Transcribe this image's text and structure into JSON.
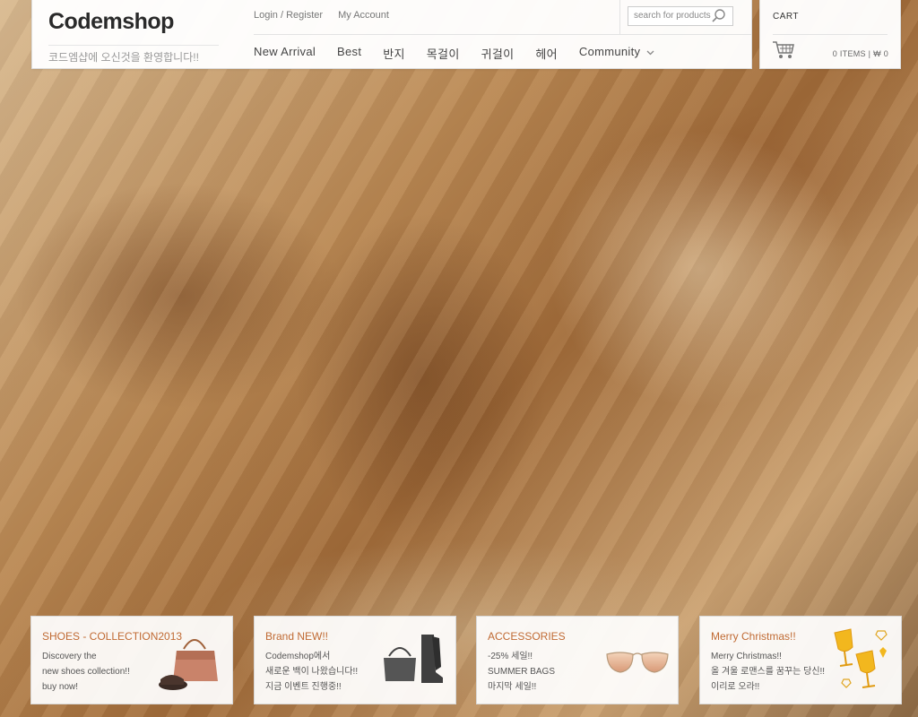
{
  "header": {
    "logo": "Codemshop",
    "tagline": "코드엠샵에 오신것을 환영합니다!!",
    "top_links": [
      "Login / Register",
      "My Account"
    ],
    "search": {
      "placeholder": "search for products",
      "icon": "search-icon"
    },
    "nav": [
      "New Arrival",
      "Best",
      "반지",
      "목걸이",
      "귀걸이",
      "헤어",
      "Community"
    ]
  },
  "cart": {
    "title": "CART",
    "icon": "shopping-cart-icon",
    "summary": "0 ITEMS | ₩ 0"
  },
  "promos": [
    {
      "title": "SHOES - COLLECTION2013",
      "lines": [
        "Discovery the",
        "new shoes collection!!",
        "buy now!"
      ],
      "icon": "handbag-and-shoes-image"
    },
    {
      "title": "Brand NEW!!",
      "lines": [
        "Codemshop에서",
        "새로운 백이 나왔습니다!!",
        "지금 이벤트 진행중!!"
      ],
      "icon": "bag-and-boots-image"
    },
    {
      "title": "ACCESSORIES",
      "lines": [
        "-25% 세일!!",
        "SUMMER BAGS",
        "마지막 세일!!"
      ],
      "icon": "sunglasses-image"
    },
    {
      "title": "Merry Christmas!!",
      "lines": [
        "Merry Christmas!!",
        "올 겨울 로맨스를 꿈꾸는 당신!!",
        "이리로 오라!!"
      ],
      "icon": "champagne-glasses-icon"
    }
  ],
  "colors": {
    "accent": "#c06a33",
    "gold": "#f2b71e"
  }
}
